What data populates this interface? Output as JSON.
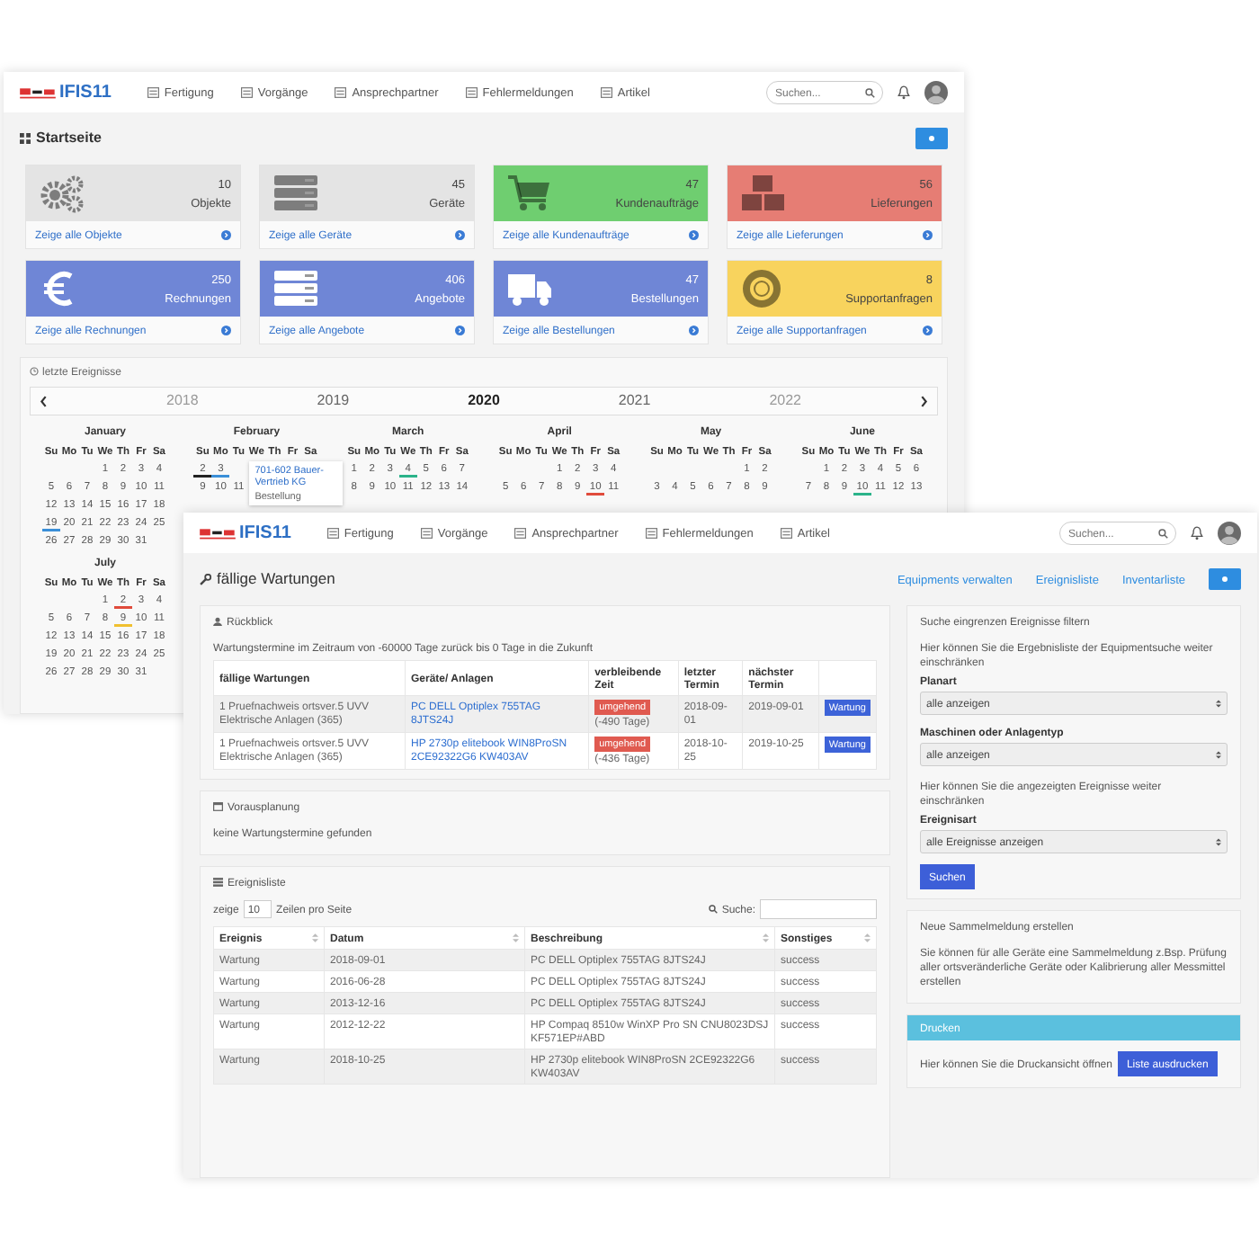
{
  "back_window": {
    "nav": {
      "logo": "IFIS11",
      "items": [
        "Fertigung",
        "Vorgänge",
        "Ansprechpartner",
        "Fehlermeldungen",
        "Artikel"
      ],
      "search": {
        "placeholder": "Suchen..."
      }
    },
    "title": "Startseite",
    "tiles": [
      {
        "count": "10",
        "label": "Objekte",
        "link": "Zeige alle Objekte",
        "color": "#e4e4e4",
        "light_text": false,
        "kind": "gears"
      },
      {
        "count": "45",
        "label": "Geräte",
        "link": "Zeige alle Geräte",
        "color": "#e4e4e4",
        "light_text": false,
        "kind": "server"
      },
      {
        "count": "47",
        "label": "Kundenaufträge",
        "link": "Zeige alle Kundenaufträge",
        "color": "#6fce70",
        "light_text": false,
        "kind": "cart"
      },
      {
        "count": "56",
        "label": "Lieferungen",
        "link": "Zeige alle Lieferungen",
        "color": "#e67d74",
        "light_text": false,
        "kind": "boxes"
      },
      {
        "count": "250",
        "label": "Rechnungen",
        "link": "Zeige alle Rechnungen",
        "color": "#6f86d6",
        "light_text": true,
        "kind": "euro"
      },
      {
        "count": "406",
        "label": "Angebote",
        "link": "Zeige alle Angebote",
        "color": "#6f86d6",
        "light_text": true,
        "kind": "server"
      },
      {
        "count": "47",
        "label": "Bestellungen",
        "link": "Zeige alle Bestellungen",
        "color": "#6f86d6",
        "light_text": true,
        "kind": "truck"
      },
      {
        "count": "8",
        "label": "Supportanfragen",
        "link": "Zeige alle Supportanfragen",
        "color": "#f8d35d",
        "light_text": false,
        "kind": "lifebuoy"
      }
    ],
    "events": {
      "title": "letzte Ereignisse",
      "years": [
        {
          "label": "2018",
          "selected": false,
          "dimmed": true
        },
        {
          "label": "2019",
          "selected": false,
          "dimmed": false
        },
        {
          "label": "2020",
          "selected": true,
          "dimmed": false
        },
        {
          "label": "2021",
          "selected": false,
          "dimmed": false
        },
        {
          "label": "2022",
          "selected": false,
          "dimmed": true
        }
      ],
      "popup": {
        "title": "701-602 Bauer-Vertrieb KG",
        "subtitle": "Bestellung"
      },
      "months": [
        {
          "name": "January",
          "weekdays": [
            "Su",
            "Mo",
            "Tu",
            "We",
            "Th",
            "Fr",
            "Sa"
          ],
          "weeks": [
            {
              "kind": "end",
              "days": [
                "1",
                "2",
                "3",
                "4"
              ]
            },
            {
              "kind": "start",
              "days": [
                "5",
                "6",
                "7",
                "8",
                "9",
                "10",
                "11"
              ]
            },
            {
              "kind": "start",
              "days": [
                "12",
                "13",
                "14",
                "15",
                "16",
                "17",
                "18"
              ]
            },
            {
              "kind": "start",
              "days": [
                {
                  "d": "19",
                  "color": "#3a8fd8"
                },
                "20",
                "21",
                "22",
                "23",
                "24",
                "25"
              ]
            },
            {
              "kind": "start",
              "days": [
                "26",
                "27",
                "28",
                "29",
                "30",
                "31"
              ]
            }
          ]
        },
        {
          "name": "February",
          "weekdays": [
            "Su",
            "Mo",
            "Tu",
            "We",
            "Th",
            "Fr",
            "Sa"
          ],
          "weeks": [
            {
              "kind": "start",
              "days": [
                {
                  "d": "2",
                  "color": "#222222"
                },
                {
                  "d": "3",
                  "color": "#3a8fd8"
                }
              ]
            },
            {
              "kind": "start",
              "days": [
                "9",
                "10",
                "11"
              ]
            }
          ]
        },
        {
          "name": "March",
          "weekdays": [
            "Su",
            "Mo",
            "Tu",
            "We",
            "Th",
            "Fr",
            "Sa"
          ],
          "weeks": [
            {
              "kind": "start",
              "days": [
                "1",
                "2",
                "3",
                {
                  "d": "4",
                  "color": "#2bb38a"
                },
                "5",
                "6",
                "7"
              ]
            },
            {
              "kind": "start",
              "days": [
                "8",
                "9",
                "10",
                "11",
                "12",
                "13",
                "14"
              ]
            }
          ]
        },
        {
          "name": "April",
          "weekdays": [
            "Su",
            "Mo",
            "Tu",
            "We",
            "Th",
            "Fr",
            "Sa"
          ],
          "weeks": [
            {
              "kind": "end",
              "days": [
                "1",
                "2",
                "3",
                "4"
              ]
            },
            {
              "kind": "start",
              "days": [
                "5",
                "6",
                "7",
                "8",
                "9",
                {
                  "d": "10",
                  "color": "#e04b3c"
                },
                "11"
              ]
            }
          ]
        },
        {
          "name": "May",
          "weekdays": [
            "Su",
            "Mo",
            "Tu",
            "We",
            "Th",
            "Fr",
            "Sa"
          ],
          "weeks": [
            {
              "kind": "end",
              "days": [
                "1",
                "2"
              ]
            },
            {
              "kind": "start",
              "days": [
                "3",
                "4",
                "5",
                "6",
                "7",
                "8",
                "9"
              ]
            }
          ]
        },
        {
          "name": "June",
          "weekdays": [
            "Su",
            "Mo",
            "Tu",
            "We",
            "Th",
            "Fr",
            "Sa"
          ],
          "weeks": [
            {
              "kind": "end",
              "days": [
                "1",
                "2",
                "3",
                "4",
                "5",
                "6"
              ]
            },
            {
              "kind": "start",
              "days": [
                "7",
                "8",
                "9",
                {
                  "d": "10",
                  "color": "#2bb38a"
                },
                "11",
                "12",
                "13"
              ]
            }
          ]
        },
        {
          "name": "July",
          "weekdays": [
            "Su",
            "Mo",
            "Tu",
            "We",
            "Th",
            "Fr",
            "Sa"
          ],
          "weeks": [
            {
              "kind": "end",
              "days": [
                "1",
                {
                  "d": "2",
                  "color": "#e04b3c"
                },
                "3",
                "4"
              ]
            },
            {
              "kind": "start",
              "days": [
                "5",
                "6",
                "7",
                "8",
                {
                  "d": "9",
                  "color": "#f0c030"
                },
                "10",
                "11"
              ]
            },
            {
              "kind": "start",
              "days": [
                "12",
                "13",
                "14",
                "15",
                "16",
                "17",
                "18"
              ]
            },
            {
              "kind": "start",
              "days": [
                "19",
                "20",
                "21",
                "22",
                "23",
                "24",
                "25"
              ]
            },
            {
              "kind": "start",
              "days": [
                "26",
                "27",
                "28",
                "29",
                "30",
                "31"
              ]
            }
          ]
        }
      ]
    }
  },
  "front_window": {
    "nav": {
      "logo": "IFIS11",
      "items": [
        "Fertigung",
        "Vorgänge",
        "Ansprechpartner",
        "Fehlermeldungen",
        "Artikel"
      ],
      "search": {
        "placeholder": "Suchen..."
      }
    },
    "title": "fällige Wartungen",
    "links": [
      "Equipments verwalten",
      "Ereignisliste",
      "Inventarliste"
    ],
    "review": {
      "title": "Rückblick",
      "note": "Wartungstermine im Zeitraum von -60000 Tage zurück bis 0 Tage in die Zukunft",
      "columns": [
        "fällige Wartungen",
        "Geräte/ Anlagen",
        "verbleibende Zeit",
        "letzter Termin",
        "nächster Termin"
      ],
      "rows": [
        {
          "task": "1 Pruefnachweis ortsver.5 UVV Elektrische Anlagen (365)",
          "device": "PC DELL Optiplex 755TAG 8JTS24J",
          "status": "umgehend",
          "remaining": "(-490 Tage)",
          "last": "2018-09-01",
          "next": "2019-09-01",
          "action": "Wartung"
        },
        {
          "task": "1 Pruefnachweis ortsver.5 UVV Elektrische Anlagen (365)",
          "device": "HP 2730p elitebook WIN8ProSN 2CE92322G6 KW403AV",
          "status": "umgehend",
          "remaining": "(-436 Tage)",
          "last": "2018-10-25",
          "next": "2019-10-25",
          "action": "Wartung"
        }
      ]
    },
    "planning": {
      "title": "Vorausplanung",
      "note": "keine Wartungstermine gefunden"
    },
    "event_list": {
      "title": "Ereignisliste",
      "show_label": "zeige",
      "page_size": "10",
      "per_page_label": "Zeilen pro Seite",
      "search_label": "Suche:",
      "columns": [
        "Ereignis",
        "Datum",
        "Beschreibung",
        "Sonstiges"
      ],
      "rows": [
        {
          "event": "Wartung",
          "date": "2018-09-01",
          "description": "PC DELL Optiplex 755TAG 8JTS24J",
          "other": "success"
        },
        {
          "event": "Wartung",
          "date": "2016-06-28",
          "description": "PC DELL Optiplex 755TAG 8JTS24J",
          "other": "success"
        },
        {
          "event": "Wartung",
          "date": "2013-12-16",
          "description": "PC DELL Optiplex 755TAG 8JTS24J",
          "other": "success"
        },
        {
          "event": "Wartung",
          "date": "2012-12-22",
          "description": "HP Compaq 8510w WinXP Pro SN CNU8023DSJ KF571EP#ABD",
          "other": "success"
        },
        {
          "event": "Wartung",
          "date": "2018-10-25",
          "description": "HP 2730p elitebook WIN8ProSN 2CE92322G6 KW403AV",
          "other": "success"
        }
      ]
    },
    "filter": {
      "title": "Suche eingrenzen Ereignisse filtern",
      "hint": "Hier können Sie die Ergebnisliste der Equipmentsuche weiter einschränken",
      "fields": [
        {
          "label": "Planart",
          "value": "alle anzeigen"
        },
        {
          "label": "Maschinen oder Anlagentyp",
          "value": "alle anzeigen"
        }
      ],
      "hint2": "Hier können Sie die angezeigten Ereignisse weiter einschränken",
      "fields2": [
        {
          "label": "Ereignisart",
          "value": "alle Ereignisse anzeigen"
        }
      ],
      "button": "Suchen"
    },
    "collective": {
      "title": "Neue Sammelmeldung erstellen",
      "text": "Sie können für alle Geräte eine Sammelmeldung z.Bsp. Prüfung aller ortsveränderliche Geräte oder Kalibrierung aller Messmittel erstellen"
    },
    "print": {
      "title": "Drucken",
      "text": "Hier können Sie die Druckansicht öffnen",
      "button": "Liste ausdrucken"
    }
  }
}
